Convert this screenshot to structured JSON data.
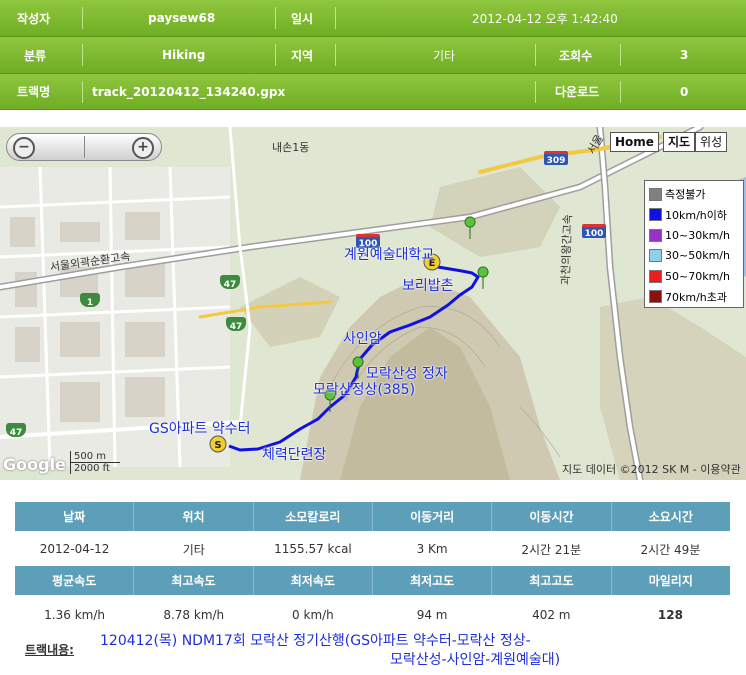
{
  "header": {
    "row1": {
      "author_label": "작성자",
      "author": "paysew68",
      "date_label": "일시",
      "date": "2012-04-12 오후 1:42:40"
    },
    "row2": {
      "category_label": "분류",
      "category": "Hiking",
      "region_label": "지역",
      "region": "기타",
      "views_label": "조회수",
      "views": "3"
    },
    "row3": {
      "track_label": "트랙명",
      "track": "track_20120412_134240.gpx",
      "downloads_label": "다운로드",
      "downloads": "0"
    }
  },
  "map": {
    "home_btn": "Home",
    "map_btn": "지도",
    "sat_btn": "위성",
    "legend": [
      {
        "label": "측정불가",
        "color": "#808080"
      },
      {
        "label": "10km/h이하",
        "color": "#1010e0"
      },
      {
        "label": "10~30km/h",
        "color": "#9a30c8"
      },
      {
        "label": "30~50km/h",
        "color": "#8fd0ea"
      },
      {
        "label": "50~70km/h",
        "color": "#ee1c1c"
      },
      {
        "label": "70km/h초과",
        "color": "#8b1010"
      }
    ],
    "labels": {
      "gyewon": "계원예술대학교",
      "bori": "보리밥촌",
      "sainam": "사인암",
      "moraksanseong": "모락산성 정자",
      "peak": "모락산정상(385)",
      "gs": "GS아파트 약수터",
      "gym": "체력단련장"
    },
    "roads": {
      "naeson": "내손1동",
      "outer": "서울외곽순환고속",
      "gwacheon": "과천의왕간고속",
      "seoul": "서울"
    },
    "shields": [
      "309",
      "100",
      "100",
      "1",
      "47",
      "47",
      "47"
    ],
    "scale_m": "500 m",
    "scale_ft": "2000 ft",
    "google": "Google",
    "copyright": "지도 데이터 ©2012 SK M - 이용약관"
  },
  "stats": {
    "header1": [
      "날짜",
      "위치",
      "소모칼로리",
      "이동거리",
      "이동시간",
      "소요시간"
    ],
    "values1": [
      "2012-04-12",
      "기타",
      "1155.57 kcal",
      "3 Km",
      "2시간 21분",
      "2시간 49분"
    ],
    "header2": [
      "평균속도",
      "최고속도",
      "최저속도",
      "최저고도",
      "최고고도",
      "마일리지"
    ],
    "values2": [
      "1.36 km/h",
      "8.78 km/h",
      "0 km/h",
      "94 m",
      "402 m",
      "128"
    ]
  },
  "track": {
    "label": "트랙내용:",
    "line1": "120412(목) NDM17회 모락산 정기산행(GS아파트 약수터-모락산 정상-",
    "line2": "모락산성-사인암-계원예술대)"
  }
}
